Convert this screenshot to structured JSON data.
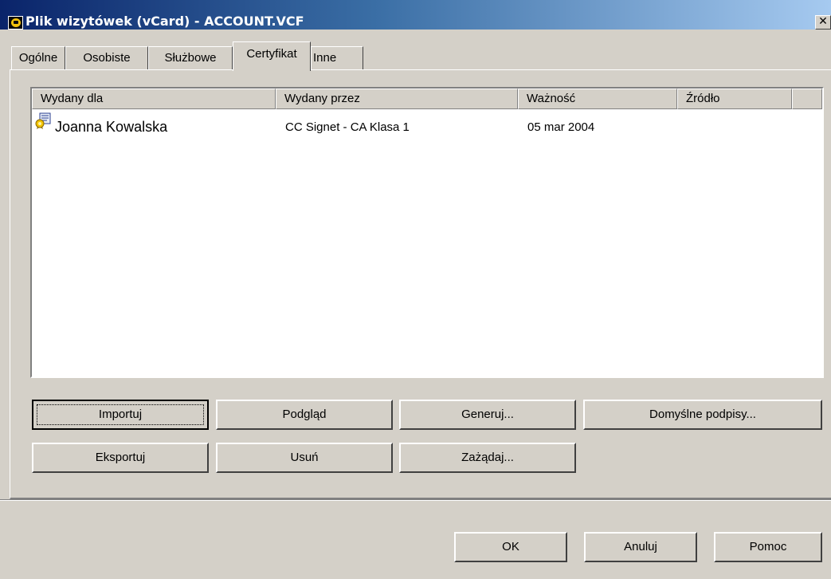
{
  "window": {
    "title": "Plik wizytówek (vCard) - ACCOUNT.VCF",
    "close_label": "✕"
  },
  "tabs": [
    {
      "label": "Ogólne",
      "active": false
    },
    {
      "label": "Osobiste",
      "active": false
    },
    {
      "label": "Służbowe",
      "active": false
    },
    {
      "label": "Certyfikat",
      "active": true
    },
    {
      "label": "Inne",
      "active": false
    }
  ],
  "list": {
    "columns": [
      "Wydany dla",
      "Wydany przez",
      "Ważność",
      "Źródło"
    ],
    "rows": [
      {
        "issued_to": "Joanna Kowalska",
        "issued_by": "CC Signet - CA Klasa 1",
        "validity": "05 mar 2004",
        "source": "",
        "icon": "certificate-icon"
      }
    ]
  },
  "buttons": {
    "import": "Importuj",
    "preview": "Podgląd",
    "generate": "Generuj...",
    "default_signatures": "Domyślne podpisy...",
    "export": "Eksportuj",
    "delete": "Usuń",
    "request": "Zażądaj...",
    "ok": "OK",
    "cancel": "Anuluj",
    "help": "Pomoc"
  },
  "colors": {
    "titlebar_start": "#0a246a",
    "titlebar_end": "#a6caf0",
    "face": "#d4d0c8"
  }
}
